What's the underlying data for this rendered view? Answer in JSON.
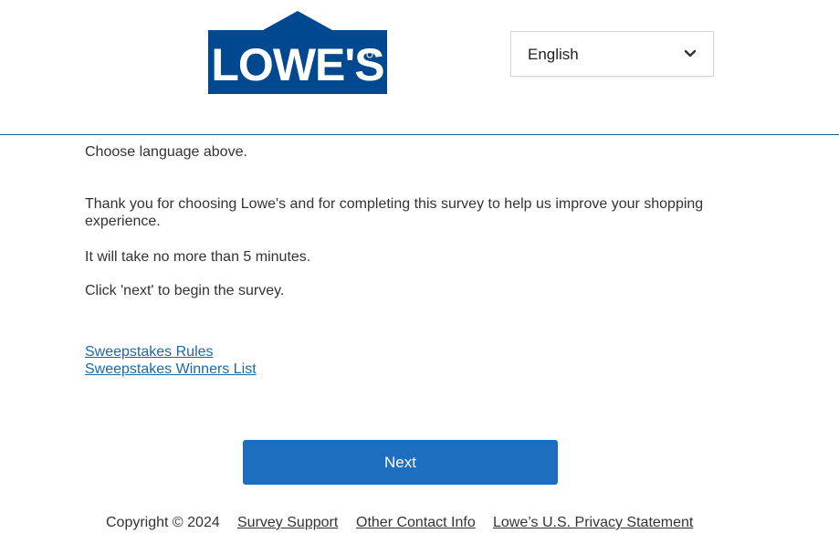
{
  "header": {
    "logo_text": "LOWE'S",
    "brand_color": "#004990",
    "language_select": {
      "selected": "English"
    }
  },
  "content": {
    "choose_language": "Choose language above.",
    "thank_you": "Thank you for choosing Lowe's and for completing this survey to help us improve your shopping experience.",
    "duration": "It will take no more than 5 minutes.",
    "instruction": "Click 'next' to begin the survey.",
    "links": {
      "rules": "Sweepstakes Rules",
      "winners": "Sweepstakes Winners List"
    }
  },
  "actions": {
    "next_label": "Next",
    "button_color": "#1d6ebf"
  },
  "footer": {
    "copyright": "Copyright © 2024",
    "survey_support": "Survey Support",
    "other_contact": "Other Contact Info",
    "privacy": "Lowe’s U.S. Privacy Statement"
  }
}
